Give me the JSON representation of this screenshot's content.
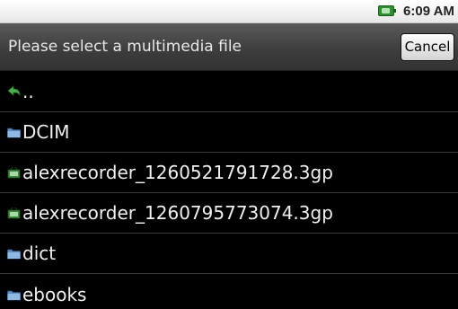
{
  "status_bar": {
    "time": "6:09 AM",
    "battery_icon": "battery-charging-icon"
  },
  "header": {
    "title": "Please select a multimedia file",
    "cancel_label": "Cancel"
  },
  "file_list": [
    {
      "label": "..",
      "icon": "back-arrow-icon",
      "type": "parent"
    },
    {
      "label": "DCIM",
      "icon": "folder-icon",
      "type": "folder"
    },
    {
      "label": "alexrecorder_1260521791728.3gp",
      "icon": "video-file-icon",
      "type": "file"
    },
    {
      "label": "alexrecorder_1260795773074.3gp",
      "icon": "video-file-icon",
      "type": "file"
    },
    {
      "label": "dict",
      "icon": "folder-icon",
      "type": "folder"
    },
    {
      "label": "ebooks",
      "icon": "folder-icon",
      "type": "folder"
    }
  ],
  "colors": {
    "background": "#000000",
    "header": "#3c3c3c",
    "text": "#f0f0f0",
    "folder": "#5d8fc4",
    "video_file": "#3d8a3d",
    "back_arrow": "#4caf50"
  }
}
